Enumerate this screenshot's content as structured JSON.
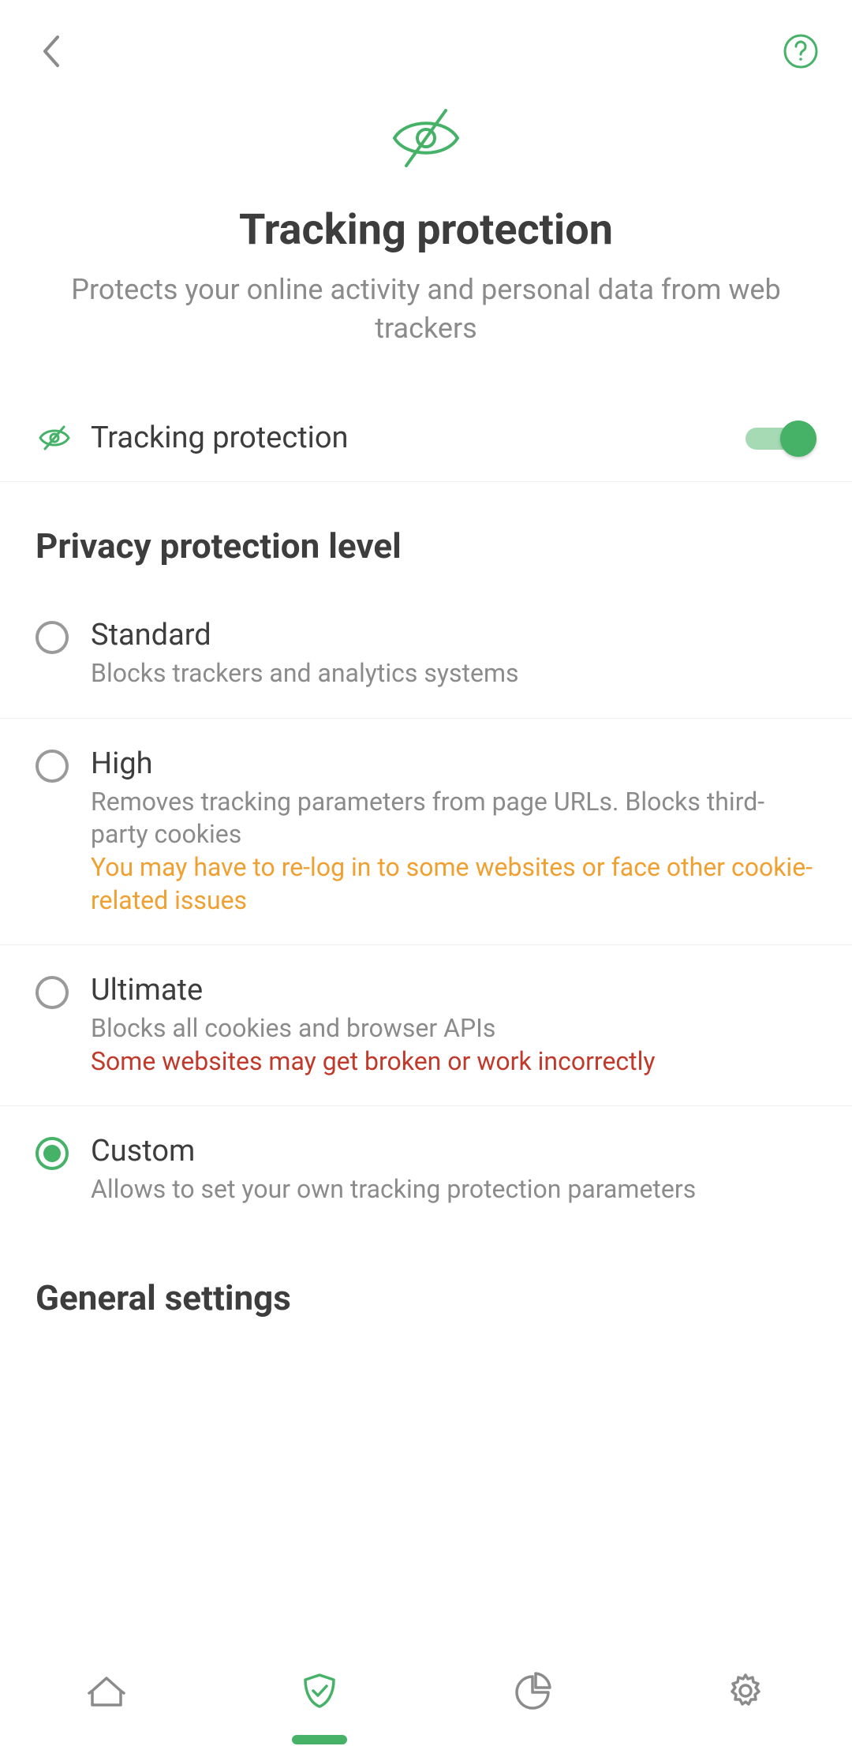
{
  "colors": {
    "accent": "#45b268",
    "warnOrange": "#f0a030",
    "warnRed": "#c0392b"
  },
  "header": {
    "title": "Tracking protection",
    "subtitle": "Protects your online activity and personal data from web trackers"
  },
  "toggleRow": {
    "icon": "eye-slash-icon",
    "label": "Tracking protection",
    "enabled": true
  },
  "sections": {
    "privacyLevelTitle": "Privacy protection level",
    "generalSettingsTitle": "General settings"
  },
  "options": [
    {
      "id": "standard",
      "title": "Standard",
      "desc": "Blocks trackers and analytics systems",
      "warning": "",
      "warningLevel": "",
      "selected": false
    },
    {
      "id": "high",
      "title": "High",
      "desc": "Removes tracking parameters from page URLs. Blocks third-party cookies",
      "warning": "You may have to re-log in to some websites or face other cookie-related issues",
      "warningLevel": "orange",
      "selected": false
    },
    {
      "id": "ultimate",
      "title": "Ultimate",
      "desc": "Blocks all cookies and browser APIs",
      "warning": "Some websites may get broken or work incorrectly",
      "warningLevel": "red",
      "selected": false
    },
    {
      "id": "custom",
      "title": "Custom",
      "desc": "Allows to set your own tracking protection parameters",
      "warning": "",
      "warningLevel": "",
      "selected": true
    }
  ],
  "nav": {
    "items": [
      "home",
      "protection",
      "stats",
      "settings"
    ],
    "activeIndex": 1
  }
}
